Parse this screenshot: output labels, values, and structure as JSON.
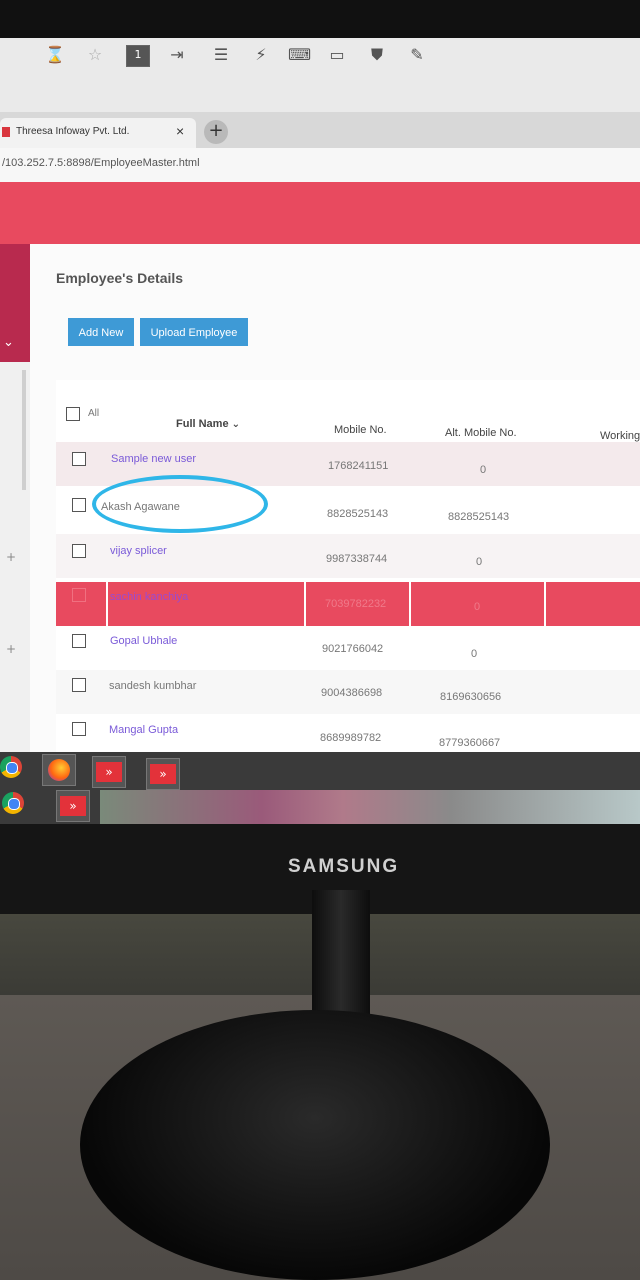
{
  "browser": {
    "tab_title": "Threesa Infoway Pvt. Ltd.",
    "tab_close": "×",
    "new_tab": "+",
    "url": "/103.252.7.5:8898/EmployeeMaster.html",
    "toolbar_badge": "1"
  },
  "page": {
    "title": "Employee's Details",
    "add_new_label": "Add New",
    "upload_label": "Upload Employee"
  },
  "table": {
    "all_label": "All",
    "columns": [
      "Full Name",
      "Mobile No.",
      "Alt. Mobile No.",
      "Working"
    ],
    "rows": [
      {
        "name": "Sample new user",
        "mobile": "1768241151",
        "alt": "0"
      },
      {
        "name": "Akash Agawane",
        "mobile": "8828525143",
        "alt": "8828525143"
      },
      {
        "name": "vijay splicer",
        "mobile": "9987338744",
        "alt": "0"
      },
      {
        "name": "sachin kanchiya",
        "mobile": "7039782232",
        "alt": "0"
      },
      {
        "name": "Gopal Ubhale",
        "mobile": "9021766042",
        "alt": "0"
      },
      {
        "name": "sandesh kumbhar",
        "mobile": "9004386698",
        "alt": "8169630656"
      },
      {
        "name": "Mangal Gupta",
        "mobile": "8689989782",
        "alt": "8779360667"
      }
    ],
    "selected_row_index": 3
  },
  "monitor": {
    "brand": "SAMSUNG"
  },
  "colors": {
    "header": "#e84a5f",
    "sidebar": "#b82a4e",
    "button": "#3e9ad6",
    "highlight_circle": "#2fb6e8"
  }
}
